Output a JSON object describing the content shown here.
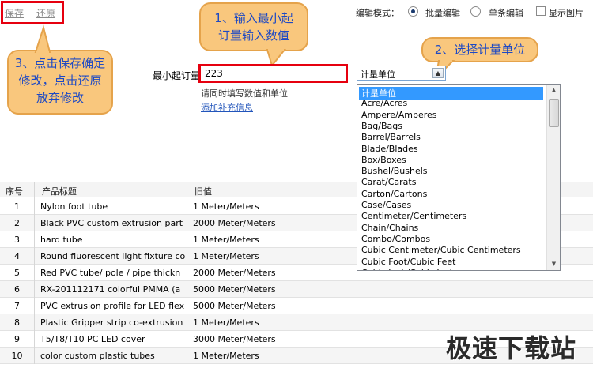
{
  "toolbar": {
    "save_label": "保存",
    "revert_label": "还原"
  },
  "edit_mode": {
    "label": "编辑模式：",
    "options": [
      {
        "label": "批量编辑",
        "selected": true
      },
      {
        "label": "单条编辑",
        "selected": false
      }
    ],
    "show_image_label": "显示图片",
    "show_image_checked": false
  },
  "form": {
    "min_order_label": "最小起订量",
    "min_order_value": "223",
    "hint": "请同时填写数值和单位",
    "add_info_link": "添加补充信息",
    "unit_select_value": "计量单位"
  },
  "annotations": {
    "step1": "1、输入最小起订量输入数值",
    "step2": "2、选择计量单位",
    "step3": "3、点击保存确定修改，点击还原放弃修改"
  },
  "table": {
    "headers": [
      "序号",
      "产品标题",
      "旧值"
    ],
    "rows": [
      {
        "no": "1",
        "title": "Nylon foot tube",
        "old": "1 Meter/Meters"
      },
      {
        "no": "2",
        "title": "Black PVC custom extrusion part",
        "old": "2000 Meter/Meters"
      },
      {
        "no": "3",
        "title": "hard tube",
        "old": "1 Meter/Meters"
      },
      {
        "no": "4",
        "title": "Round fluorescent light fixture co",
        "old": "1 Meter/Meters"
      },
      {
        "no": "5",
        "title": "Red PVC tube/ pole / pipe thickn",
        "old": "2000 Meter/Meters"
      },
      {
        "no": "6",
        "title": "RX-201112171 colorful PMMA (a",
        "old": "5000 Meter/Meters"
      },
      {
        "no": "7",
        "title": "PVC extrusion profile for LED flex",
        "old": "5000 Meter/Meters"
      },
      {
        "no": "8",
        "title": "Plastic Gripper strip co-extrusion",
        "old": "1 Meter/Meters"
      },
      {
        "no": "9",
        "title": "T5/T8/T10 PC LED cover",
        "old": "3000 Meter/Meters"
      },
      {
        "no": "10",
        "title": "color custom plastic tubes",
        "old": "1 Meter/Meters"
      }
    ]
  },
  "unit_dropdown": {
    "items": [
      "计量单位",
      "Acre/Acres",
      "Ampere/Amperes",
      "Bag/Bags",
      "Barrel/Barrels",
      "Blade/Blades",
      "Box/Boxes",
      "Bushel/Bushels",
      "Carat/Carats",
      "Carton/Cartons",
      "Case/Cases",
      "Centimeter/Centimeters",
      "Chain/Chains",
      "Combo/Combos",
      "Cubic Centimeter/Cubic Centimeters",
      "Cubic Foot/Cubic Feet",
      "Cubic Inch/Cubic Inches"
    ],
    "selected_index": 0
  },
  "watermark": "极速下载站",
  "colors": {
    "highlight": "#e6000f",
    "bubble_fill": "#f9c77d",
    "bubble_text": "#1d49c4",
    "selection": "#3399ff"
  }
}
